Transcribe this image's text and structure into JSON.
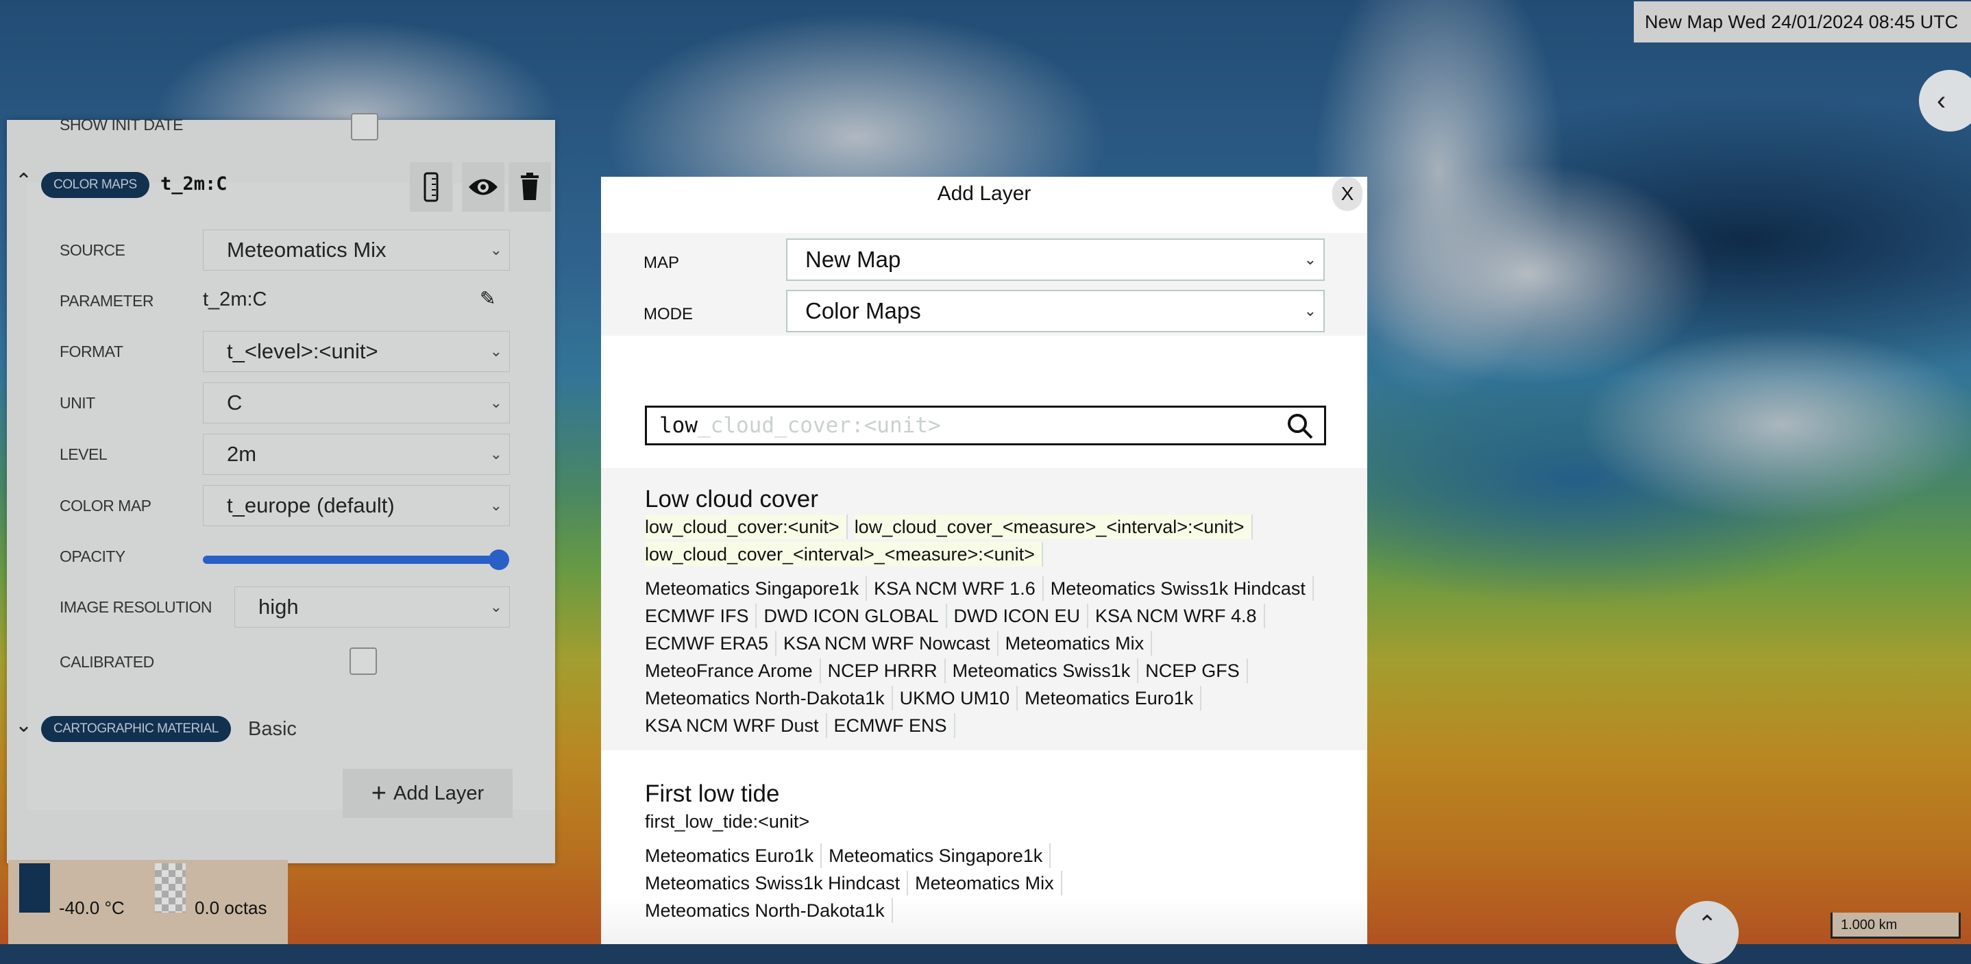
{
  "header": {
    "datetime": "New Map Wed  24/01/2024  08:45 UTC",
    "collapse_icon": "chevron-left-icon"
  },
  "layer_panel": {
    "show_init_date_label": "SHOW INIT DATE",
    "show_init_date_checked": false,
    "layer": {
      "badge": "COLOR MAPS",
      "name": "t_2m:C",
      "expand_icon": "chevron-up-icon",
      "actions": [
        "ruler-icon",
        "eye-icon",
        "trash-icon"
      ],
      "fields": {
        "source": {
          "label": "SOURCE",
          "value": "Meteomatics Mix"
        },
        "parameter": {
          "label": "PARAMETER",
          "value": "t_2m:C"
        },
        "format": {
          "label": "FORMAT",
          "value": "t_<level>:<unit>"
        },
        "unit": {
          "label": "UNIT",
          "value": "C"
        },
        "level": {
          "label": "LEVEL",
          "value": "2m"
        },
        "color_map": {
          "label": "COLOR MAP",
          "value": "t_europe (default)"
        },
        "opacity": {
          "label": "OPACITY",
          "value": 1.0
        },
        "image_resolution": {
          "label": "IMAGE RESOLUTION",
          "value": "high"
        },
        "calibrated": {
          "label": "CALIBRATED",
          "checked": false
        }
      }
    },
    "cartographic": {
      "badge": "CARTOGRAPHIC MATERIAL",
      "name": "Basic",
      "expand_icon": "chevron-down-icon"
    },
    "add_layer_label": "Add Layer"
  },
  "legend": {
    "temperature_min": "-40.0 °C",
    "cloud_min": "0.0 octas"
  },
  "scale_bar": "1.000 km",
  "modal": {
    "title": "Add Layer",
    "close_label": "X",
    "map_label": "MAP",
    "map_value": "New Map",
    "mode_label": "MODE",
    "mode_value": "Color Maps",
    "search": {
      "typed": "low",
      "suggestion": "_cloud_cover:<unit>"
    },
    "results": [
      {
        "title": "Low cloud cover",
        "parameters": [
          "low_cloud_cover:<unit>",
          "low_cloud_cover_<measure>_<interval>:<unit>",
          "low_cloud_cover_<interval>_<measure>:<unit>"
        ],
        "sources": [
          "Meteomatics Singapore1k",
          "KSA NCM WRF 1.6",
          "Meteomatics Swiss1k Hindcast",
          "ECMWF IFS",
          "DWD ICON GLOBAL",
          "DWD ICON EU",
          "KSA NCM WRF 4.8",
          "ECMWF ERA5",
          "KSA NCM WRF Nowcast",
          "Meteomatics Mix",
          "MeteoFrance Arome",
          "NCEP HRRR",
          "Meteomatics Swiss1k",
          "NCEP GFS",
          "Meteomatics North-Dakota1k",
          "UKMO UM10",
          "Meteomatics Euro1k",
          "KSA NCM WRF Dust",
          "ECMWF ENS"
        ]
      },
      {
        "title": "First low tide",
        "parameters": [
          "first_low_tide:<unit>"
        ],
        "sources": [
          "Meteomatics Euro1k",
          "Meteomatics Singapore1k",
          "Meteomatics Swiss1k Hindcast",
          "Meteomatics Mix",
          "Meteomatics North-Dakota1k"
        ]
      }
    ]
  }
}
